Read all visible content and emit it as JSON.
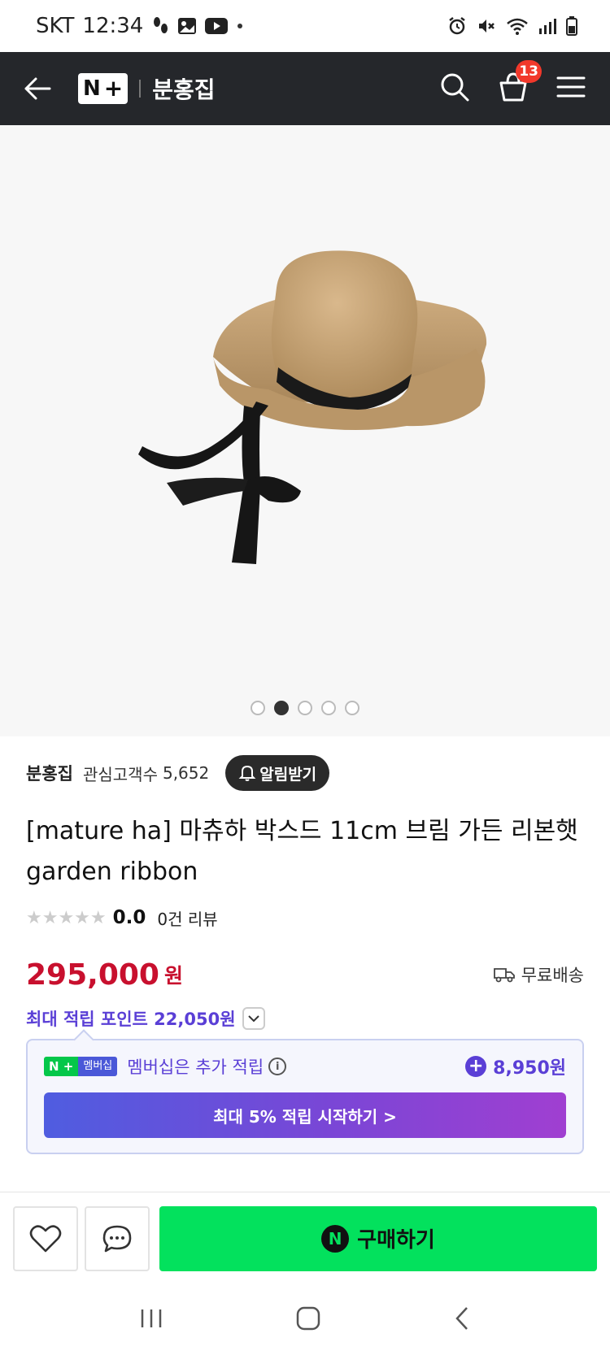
{
  "status_bar": {
    "carrier": "SKT",
    "time": "12:34",
    "left_icons": [
      "footprints-icon",
      "gallery-icon",
      "youtube-icon",
      "dot-icon"
    ],
    "right_icons": [
      "alarm-icon",
      "mute-icon",
      "wifi-icon",
      "signal-icon",
      "battery-icon"
    ]
  },
  "header": {
    "logo_n": "N",
    "logo_plus": "+",
    "store_name": "분홍집",
    "cart_count": "13"
  },
  "gallery": {
    "slides_total": 5,
    "active_index": 1
  },
  "product": {
    "seller": "분홍집",
    "follower_label": "관심고객수",
    "follower_count": "5,652",
    "alarm_label": "알림받기",
    "title": "[mature ha] 마츄하 박스드 11cm 브림 가든 리본햇 garden ribbon",
    "stars": "★★★★★",
    "rating": "0.0",
    "review_count": "0건 리뷰",
    "price": "295,000",
    "price_unit": "원",
    "shipping_label": "무료배송",
    "max_points_label": "최대 적립 포인트 22,050원"
  },
  "membership": {
    "badge_n": "N +",
    "badge_text": "멤버십",
    "description": "멤버십은 추가 적립",
    "info": "i",
    "bonus": "8,950원",
    "cta": "최대 5% 적립 시작하기 >"
  },
  "actions": {
    "buy_icon": "N",
    "buy_label": "구매하기"
  },
  "colors": {
    "header_bg": "#25272b",
    "price": "#c8102e",
    "points": "#5a3fd6",
    "buy": "#03e15d",
    "badge": "#f2382b"
  }
}
